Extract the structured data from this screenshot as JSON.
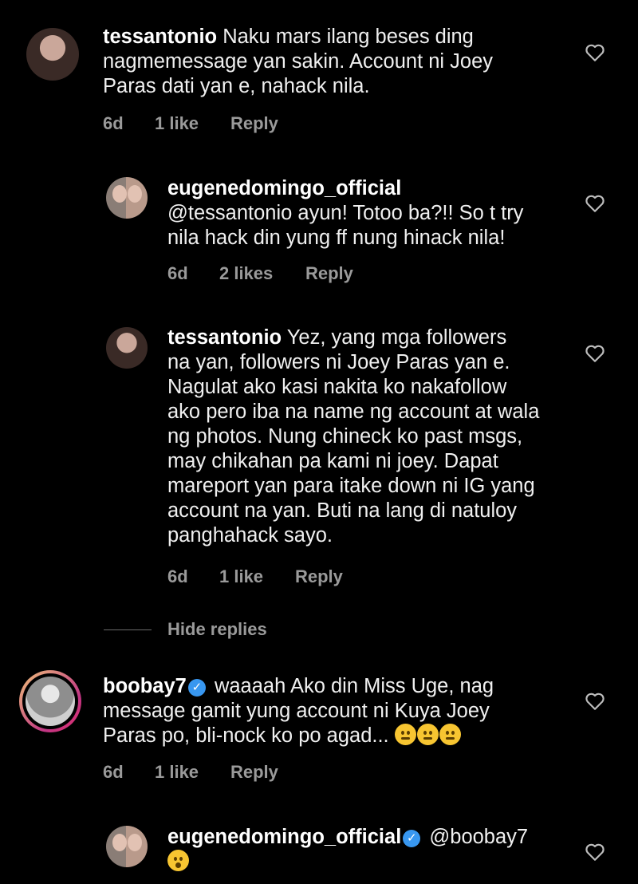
{
  "comments": [
    {
      "username": "tessantonio",
      "lines": [
        "Naku mars ilang beses ding",
        "nagmemessage yan sakin. Account ni Joey",
        "Paras dati yan e, nahack nila."
      ],
      "time": "6d",
      "likes": "1 like",
      "reply": "Reply"
    },
    {
      "username": "eugenedomingo_official",
      "lines": [
        "@tessantonio ayun! Totoo ba?!! So t try",
        "nila hack din yung ff nung hinack nila!"
      ],
      "time": "6d",
      "likes": "2 likes",
      "reply": "Reply"
    },
    {
      "username": "tessantonio",
      "lines": [
        "Yez, yang mga followers",
        "na yan, followers ni Joey Paras yan e.",
        "Nagulat ako kasi nakita ko nakafollow",
        "ako pero iba na name ng account at wala",
        "ng photos. Nung chineck ko past msgs,",
        "may chikahan pa kami ni joey. Dapat",
        "mareport yan para itake down ni IG yang",
        "account na yan. Buti na lang di natuloy",
        "panghahack sayo."
      ],
      "time": "6d",
      "likes": "1 like",
      "reply": "Reply"
    },
    {
      "username": "boobay7",
      "lines": [
        "waaaah Ako din Miss Uge, nag",
        "message gamit yung account ni Kuya Joey",
        "Paras po, bli-nock ko po agad..."
      ],
      "time": "6d",
      "likes": "1 like",
      "reply": "Reply"
    },
    {
      "username": "eugenedomingo_official",
      "lines": [
        "@boobay7"
      ]
    }
  ],
  "hide_replies": "Hide replies",
  "icons": {
    "heart": "heart-outline-icon",
    "verified": "verified-badge-icon",
    "emoji_smile": "smiling-face-emoji",
    "emoji_wow": "hushed-face-emoji"
  },
  "colors": {
    "background": "#000000",
    "text": "#f0f0f0",
    "meta": "#9a9a9a",
    "verified": "#3897f0"
  }
}
